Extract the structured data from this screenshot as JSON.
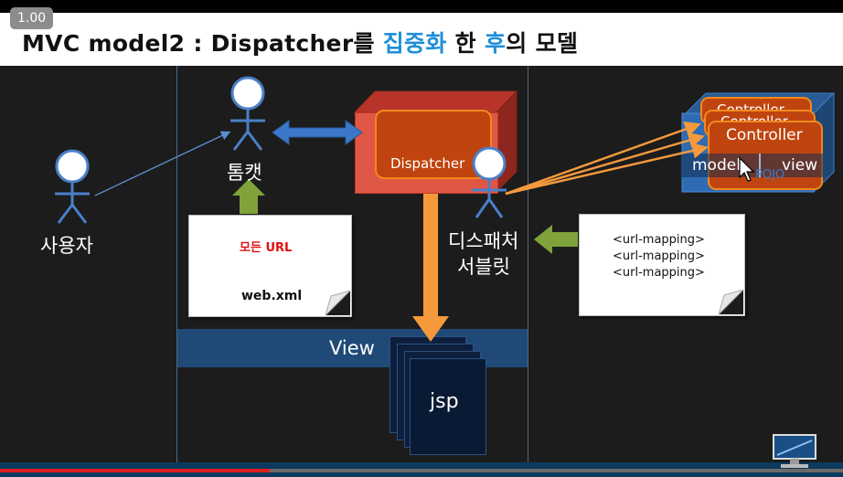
{
  "player": {
    "speed": "1.00",
    "progress_fraction": 0.32
  },
  "title": {
    "part1": "MVC model2 : Dispatcher를 ",
    "part2": "집중화",
    "part3": " 한 ",
    "part4": "후",
    "part5": "의 모델"
  },
  "actors": {
    "user": "사용자",
    "tomcat": "톰캣",
    "servlet_line1": "디스패처",
    "servlet_line2": "서블릿"
  },
  "webxml_note": {
    "text": "모든 URL",
    "file": "web.xml"
  },
  "url_mapping_note": {
    "lines": [
      "<url-mapping>",
      "<url-mapping>",
      "<url-mapping>"
    ]
  },
  "dispatcher": {
    "label": "Dispatcher"
  },
  "controller_group": {
    "cards": [
      "Controller",
      "Controller",
      "Controller"
    ],
    "model_label": "model",
    "view_label": "view",
    "pojo_label": "POJO"
  },
  "view_band": {
    "label": "View"
  },
  "jsp": {
    "label": "jsp"
  },
  "colors": {
    "accent_blue": "#1f8fd8",
    "dispatcher_red": "#e05745",
    "controller_orange": "#c0440f",
    "arrow_orange": "#f59a3c",
    "arrow_green": "#7fa33a"
  }
}
